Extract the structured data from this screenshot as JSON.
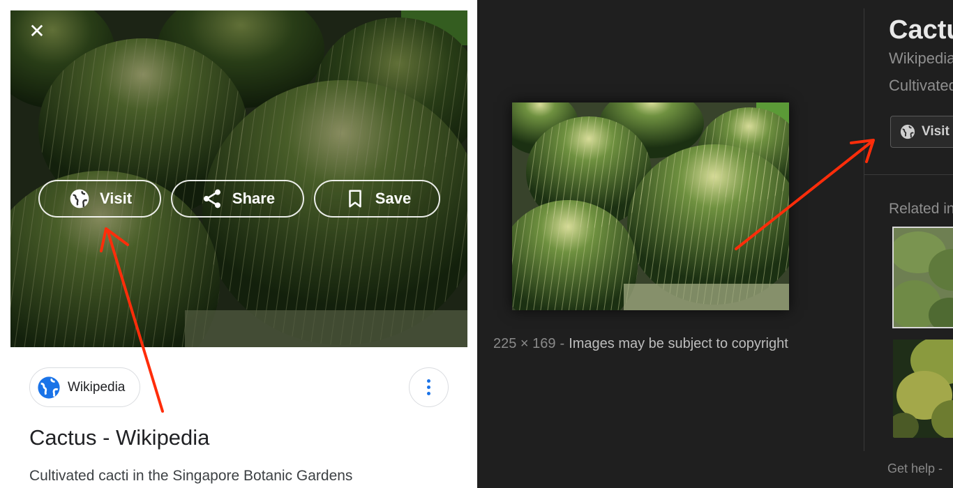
{
  "mobile_view": {
    "close_icon": "close-icon",
    "actions": [
      {
        "label": "Visit",
        "icon": "globe-icon"
      },
      {
        "label": "Share",
        "icon": "share-icon"
      },
      {
        "label": "Save",
        "icon": "bookmark-icon"
      }
    ],
    "source_chip": {
      "label": "Wikipedia",
      "icon": "globe-icon",
      "icon_color": "#1a73e8"
    },
    "more_icon": "more-vert-icon",
    "title": "Cactus - Wikipedia",
    "description": "Cultivated cacti in the Singapore Botanic Gardens"
  },
  "desktop_view": {
    "image_size": "225 × 169",
    "separator": "-",
    "copyright_notice": "Images may be subject to copyright",
    "title": "Cactu",
    "source": "Wikipedia",
    "description": "Cultivated",
    "visit_label": "Visit",
    "related_label": "Related in",
    "help_label": "Get help  -"
  },
  "annotation": {
    "arrow_color": "#ff2d0a"
  }
}
